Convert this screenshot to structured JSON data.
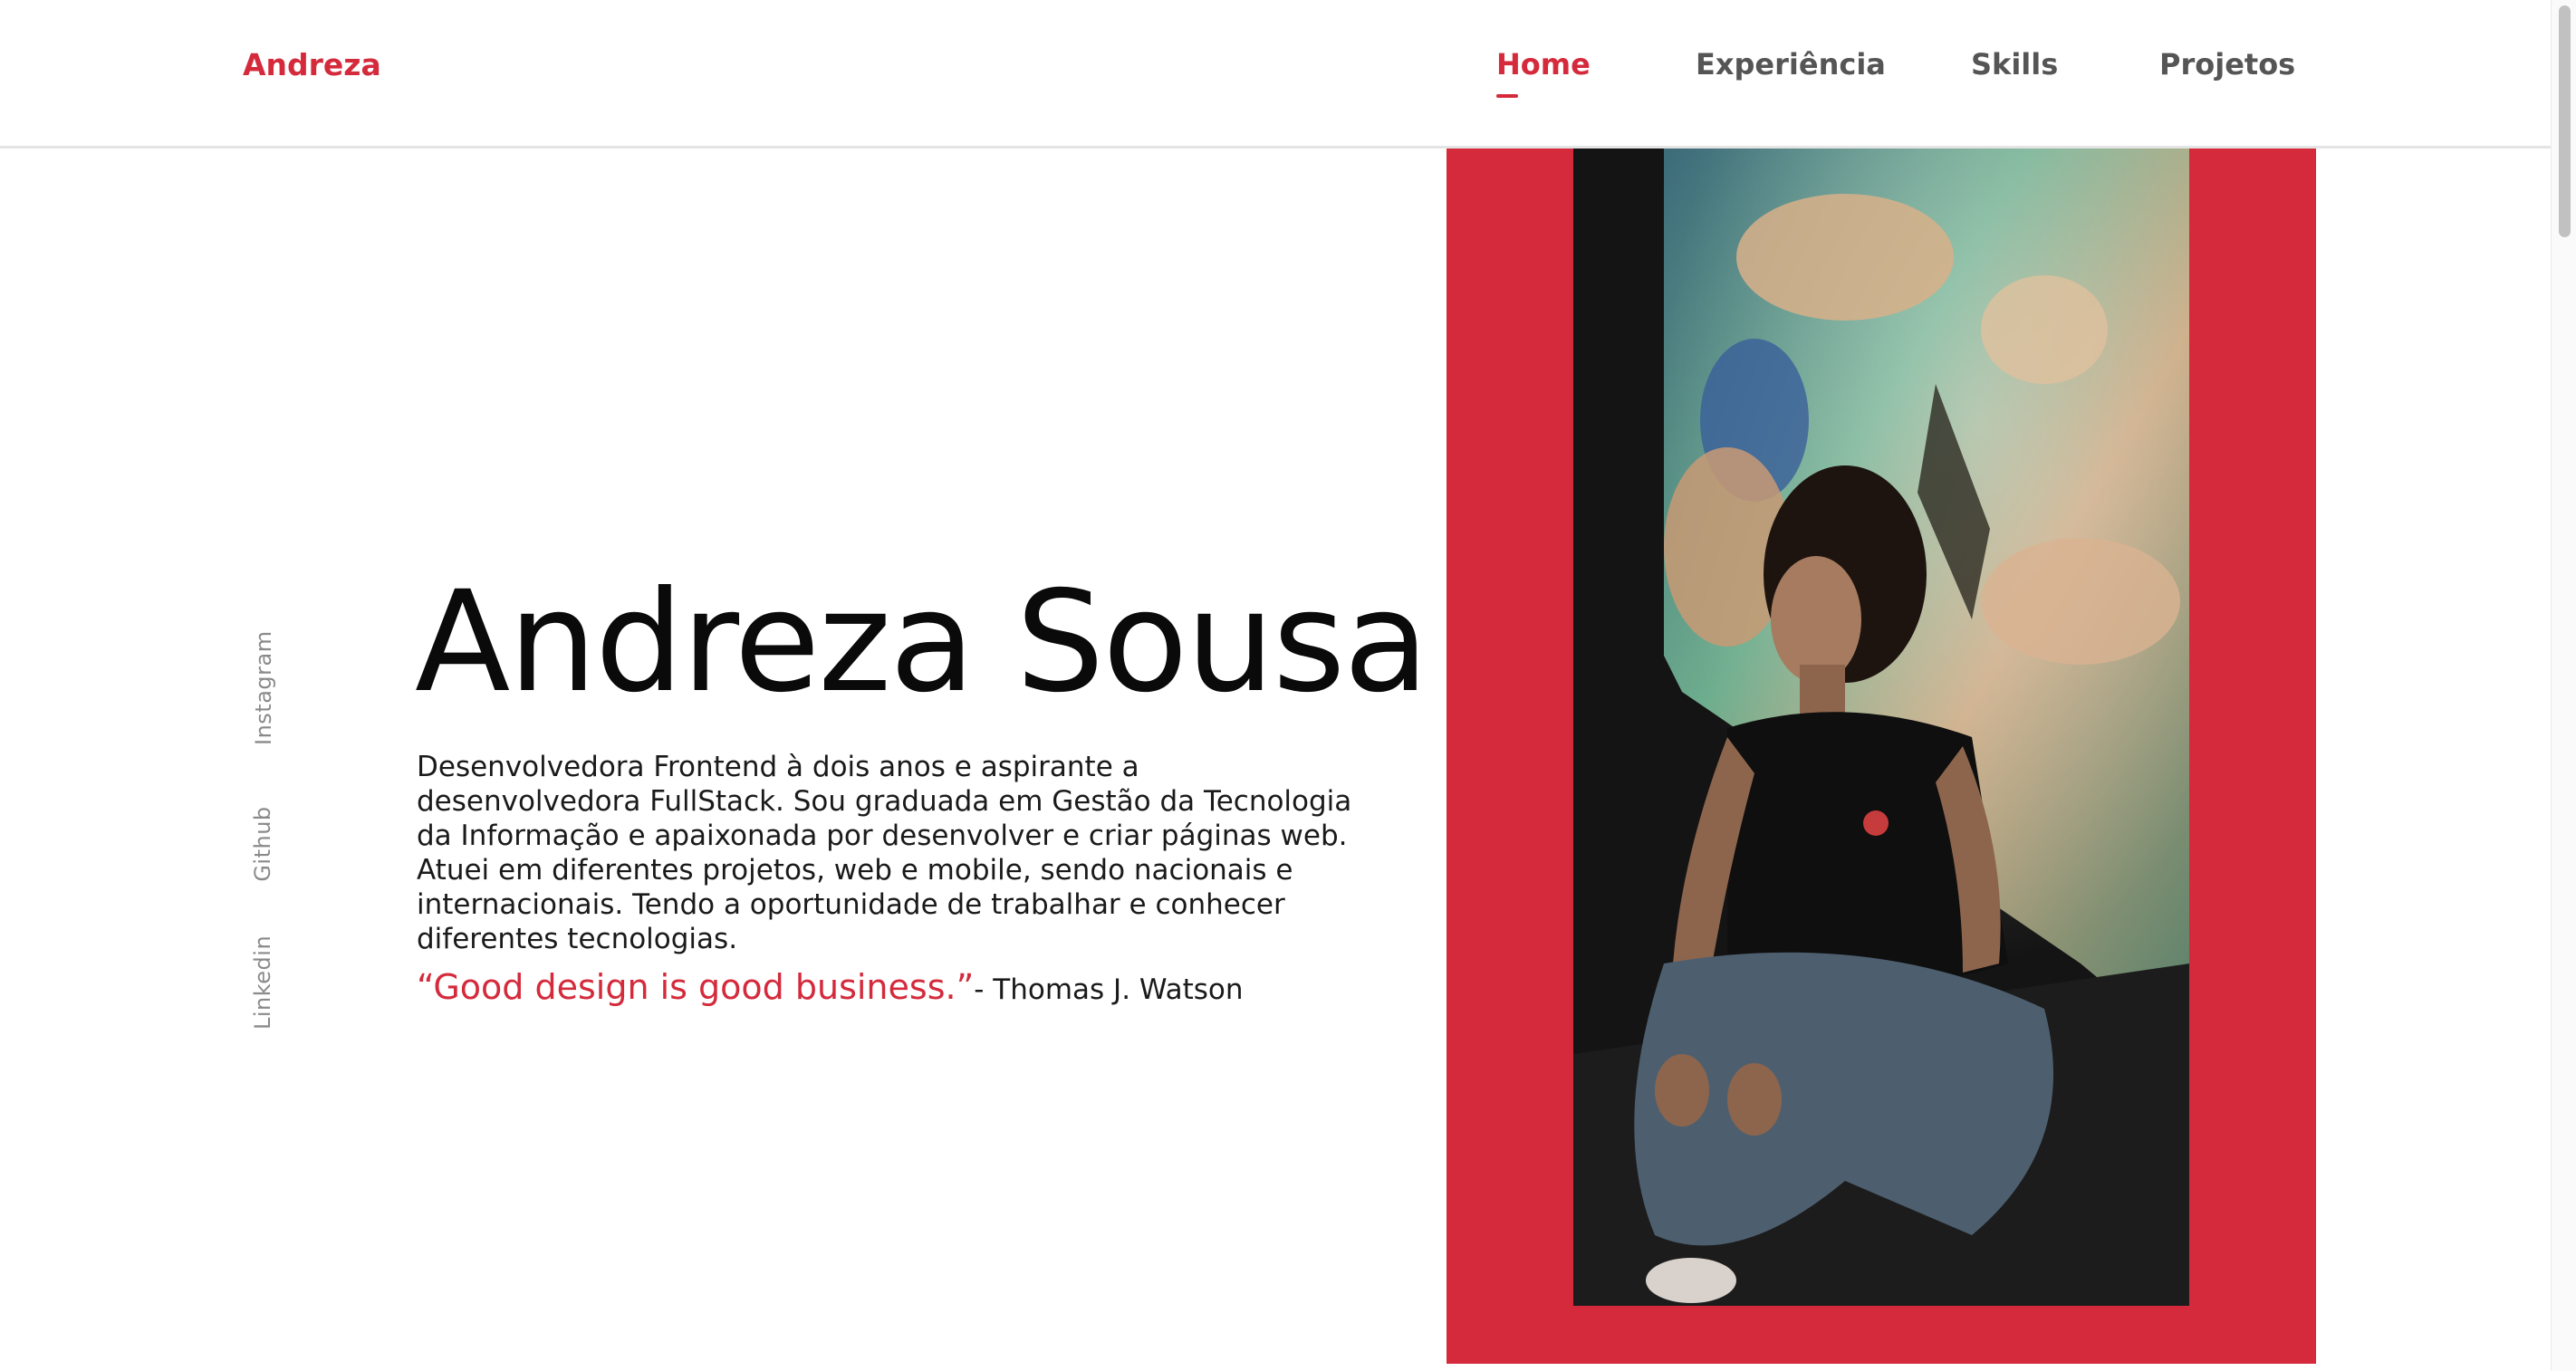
{
  "header": {
    "logo": "Andreza",
    "nav": [
      {
        "label": "Home",
        "active": true
      },
      {
        "label": "Experiência",
        "active": false
      },
      {
        "label": "Skills",
        "active": false
      },
      {
        "label": "Projetos",
        "active": false
      }
    ]
  },
  "social": {
    "instagram": "Instagram",
    "github": "Github",
    "linkedin": "Linkedin"
  },
  "hero": {
    "name": "Andreza Sousa",
    "description": "Desenvolvedora Frontend à dois anos e aspirante a desenvolvedora FullStack. Sou graduada em Gestão da Tecnologia da Informação e apaixonada por desenvolver e criar páginas web. Atuei em diferentes projetos, web e mobile, sendo nacionais e internacionais. Tendo a oportunidade de trabalhar e conhecer diferentes tecnologias.",
    "quote": "“Good design is good business.”",
    "quote_author": "- Thomas J. Watson"
  },
  "colors": {
    "accent": "#d42a3c",
    "text": "#0a0a0a",
    "muted": "#8a8a8a"
  }
}
